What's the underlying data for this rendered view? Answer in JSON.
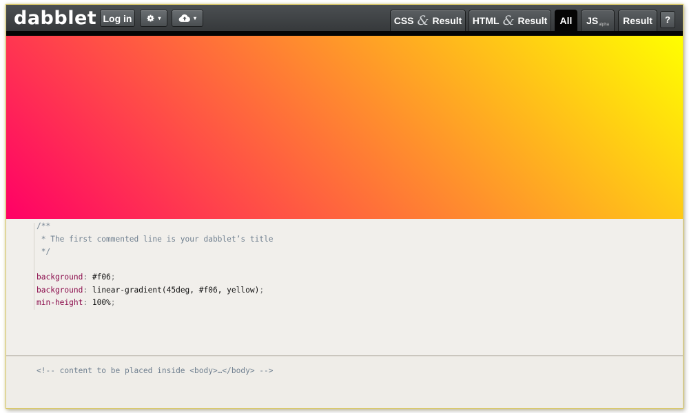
{
  "app": {
    "logo": "dabblet"
  },
  "toolbar": {
    "login_label": "Log in",
    "settings_icon": "gear-icon",
    "cloud_icon": "cloud-upload-icon",
    "caret": "▾",
    "tabs": [
      {
        "pre": "CSS",
        "amp": "&",
        "post": "Result",
        "active": false
      },
      {
        "pre": "HTML",
        "amp": "&",
        "post": "Result",
        "active": false
      },
      {
        "pre": "All",
        "active": true
      },
      {
        "pre": "JS",
        "sub": "alpha",
        "active": false
      },
      {
        "pre": "Result",
        "active": false
      }
    ],
    "help_label": "?"
  },
  "result": {
    "background_start": "#f06",
    "background_end": "yellow"
  },
  "css_editor": {
    "lines": [
      {
        "comment": "/**"
      },
      {
        "comment": " * The first commented line is your dabblet’s title"
      },
      {
        "comment": " */"
      },
      {
        "blank": ""
      },
      {
        "prop": "background",
        "sep": ": ",
        "value": "#f06",
        "end": ";"
      },
      {
        "prop": "background",
        "sep": ": ",
        "value": "linear-gradient(45deg, #f06, yellow)",
        "end": ";"
      },
      {
        "prop": "min-height",
        "sep": ": ",
        "value": "100%",
        "end": ";"
      }
    ]
  },
  "html_editor": {
    "comment": "<!-- content to be placed inside <body>…</body> -->"
  }
}
